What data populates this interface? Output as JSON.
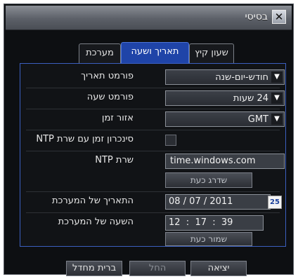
{
  "window": {
    "title": "בסיסי"
  },
  "tabs": [
    {
      "label": "שעון קיץ"
    },
    {
      "label": "תאריך ושעה"
    },
    {
      "label": "מערכת"
    }
  ],
  "settings": {
    "date_format": {
      "label": "פורמט תאריך",
      "value": "חודש-יום-שנה"
    },
    "time_format": {
      "label": "פורמט שעה",
      "value": "24 שעות"
    },
    "timezone": {
      "label": "אזור זמן",
      "value": "GMT"
    },
    "ntp_sync": {
      "label": "סינכרון זמן עם שרת NTP",
      "checked": false
    },
    "ntp_server": {
      "label": "שרת NTP",
      "value": "time.windows.com"
    },
    "update_now_label": "שדרג כעת",
    "system_date": {
      "label": "התאריך של המערכת",
      "value": "08 / 07 / 2011",
      "calendar_badge": "25"
    },
    "system_time": {
      "label": "השעה של המערכת",
      "value": "12  :  17  :  39"
    },
    "save_now_label": "שמור כעת"
  },
  "footer": {
    "exit_label": "יציאה",
    "apply_label": "החל",
    "default_label": "ברית מחדל"
  }
}
